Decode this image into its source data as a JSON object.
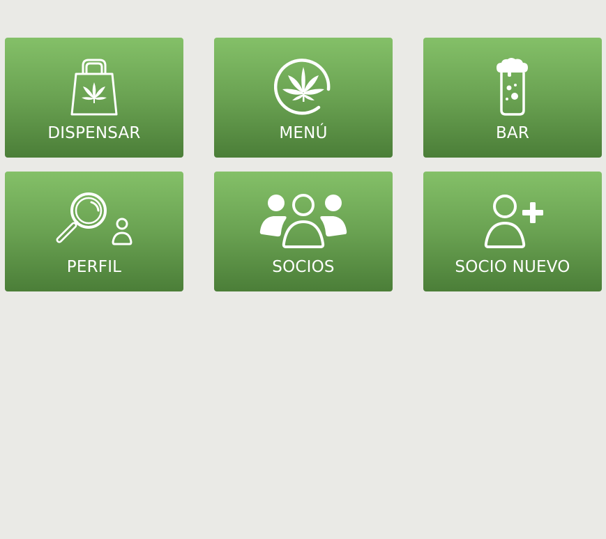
{
  "dashboard": {
    "tiles": [
      {
        "label": "DISPENSAR",
        "icon": "shopping-bag-cannabis-icon"
      },
      {
        "label": "MENÚ",
        "icon": "cannabis-leaf-circle-icon"
      },
      {
        "label": "BAR",
        "icon": "beer-glass-icon"
      },
      {
        "label": "PERFIL",
        "icon": "magnifier-person-icon"
      },
      {
        "label": "SOCIOS",
        "icon": "group-members-icon"
      },
      {
        "label": "SOCIO NUEVO",
        "icon": "add-user-icon"
      }
    ]
  },
  "colors": {
    "background": "#eaeae6",
    "tile_gradient_top": "#84c068",
    "tile_gradient_bottom": "#4b7e38",
    "tile_text": "#ffffff"
  }
}
